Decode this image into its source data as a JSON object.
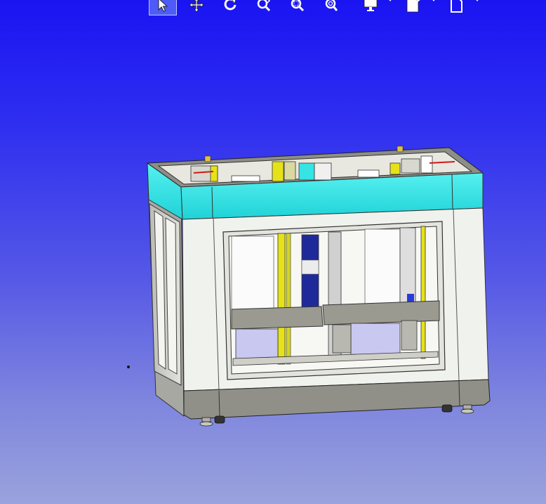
{
  "app": {
    "type": "3D CAD viewer",
    "background_top": "#1a14f2",
    "background_bottom": "#9aa3dc"
  },
  "toolbar": {
    "buttons": [
      {
        "id": "select",
        "icon": "cursor-arrow-icon",
        "active": true
      },
      {
        "id": "pan",
        "icon": "move-arrows-icon",
        "active": false
      },
      {
        "id": "rotate",
        "icon": "rotate-icon",
        "active": false
      },
      {
        "id": "zoom-dynamic",
        "icon": "zoom-dynamic-icon",
        "active": false
      },
      {
        "id": "zoom-window",
        "icon": "zoom-window-icon",
        "active": false
      },
      {
        "id": "zoom-fit",
        "icon": "zoom-fit-icon",
        "active": false
      },
      {
        "id": "display-mode",
        "icon": "monitor-icon",
        "active": false,
        "dropdown": true
      },
      {
        "id": "section",
        "icon": "section-view-icon",
        "active": false,
        "dropdown": true
      },
      {
        "id": "view-orientation",
        "icon": "view-cube-icon",
        "active": false,
        "dropdown": true
      }
    ]
  },
  "model": {
    "description_colors": {
      "frame_gray": "#8e8e8a",
      "panel_white": "#eef0ee",
      "top_cyan": "#2ee0e0",
      "yellow_rail": "#e6e21a",
      "plate_gray": "#9a9a90",
      "box_lavender": "#c8c8f0"
    }
  }
}
